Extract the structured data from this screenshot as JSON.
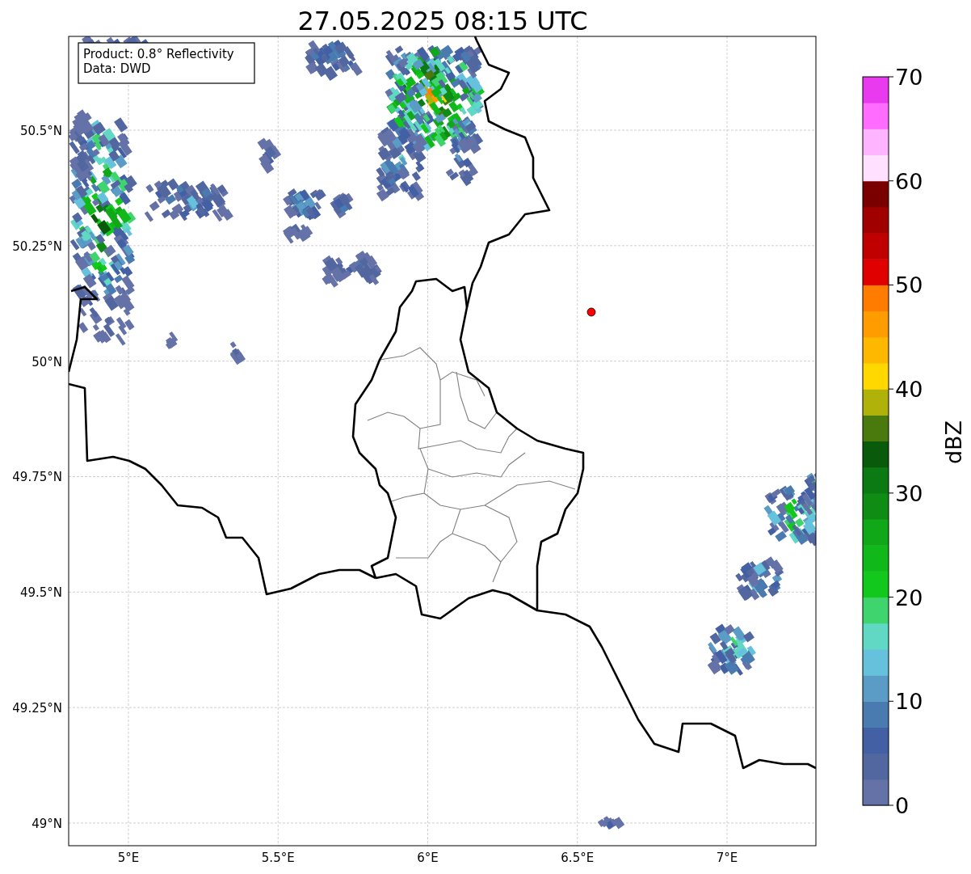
{
  "title": "27.05.2025 08:15 UTC",
  "info_box": {
    "lines": [
      "Product: 0.8° Reflectivity",
      "Data: DWD"
    ]
  },
  "map": {
    "x_ticks": [
      "5°E",
      "5.5°E",
      "6°E",
      "6.5°E",
      "7°E"
    ],
    "y_ticks": [
      "50.5°N",
      "50.25°N",
      "50°N",
      "49.75°N",
      "49.5°N",
      "49.25°N",
      "49°N"
    ]
  },
  "colorbar": {
    "label": "dBZ",
    "ticks": [
      "70",
      "60",
      "50",
      "40",
      "30",
      "20",
      "10",
      "0"
    ],
    "segments": [
      {
        "color": "#6572a8"
      },
      {
        "color": "#52669f"
      },
      {
        "color": "#4460a4"
      },
      {
        "color": "#4a7bb0"
      },
      {
        "color": "#5a9cc6"
      },
      {
        "color": "#66c2dc"
      },
      {
        "color": "#60d8c4"
      },
      {
        "color": "#3fd46e"
      },
      {
        "color": "#13c81c"
      },
      {
        "color": "#10b81a"
      },
      {
        "color": "#10a818"
      },
      {
        "color": "#0e8c14"
      },
      {
        "color": "#0b7a12"
      },
      {
        "color": "#0a5a0c"
      },
      {
        "color": "#4a7a0e"
      },
      {
        "color": "#b0b20a"
      },
      {
        "color": "#ffd800"
      },
      {
        "color": "#ffb800"
      },
      {
        "color": "#ff9c00"
      },
      {
        "color": "#ff7c00"
      },
      {
        "color": "#e00000"
      },
      {
        "color": "#c00000"
      },
      {
        "color": "#a00000"
      },
      {
        "color": "#7a0000"
      },
      {
        "color": "#ffe0ff"
      },
      {
        "color": "#ffb4ff"
      },
      {
        "color": "#ff6cff"
      },
      {
        "color": "#ea3af0"
      }
    ]
  }
}
